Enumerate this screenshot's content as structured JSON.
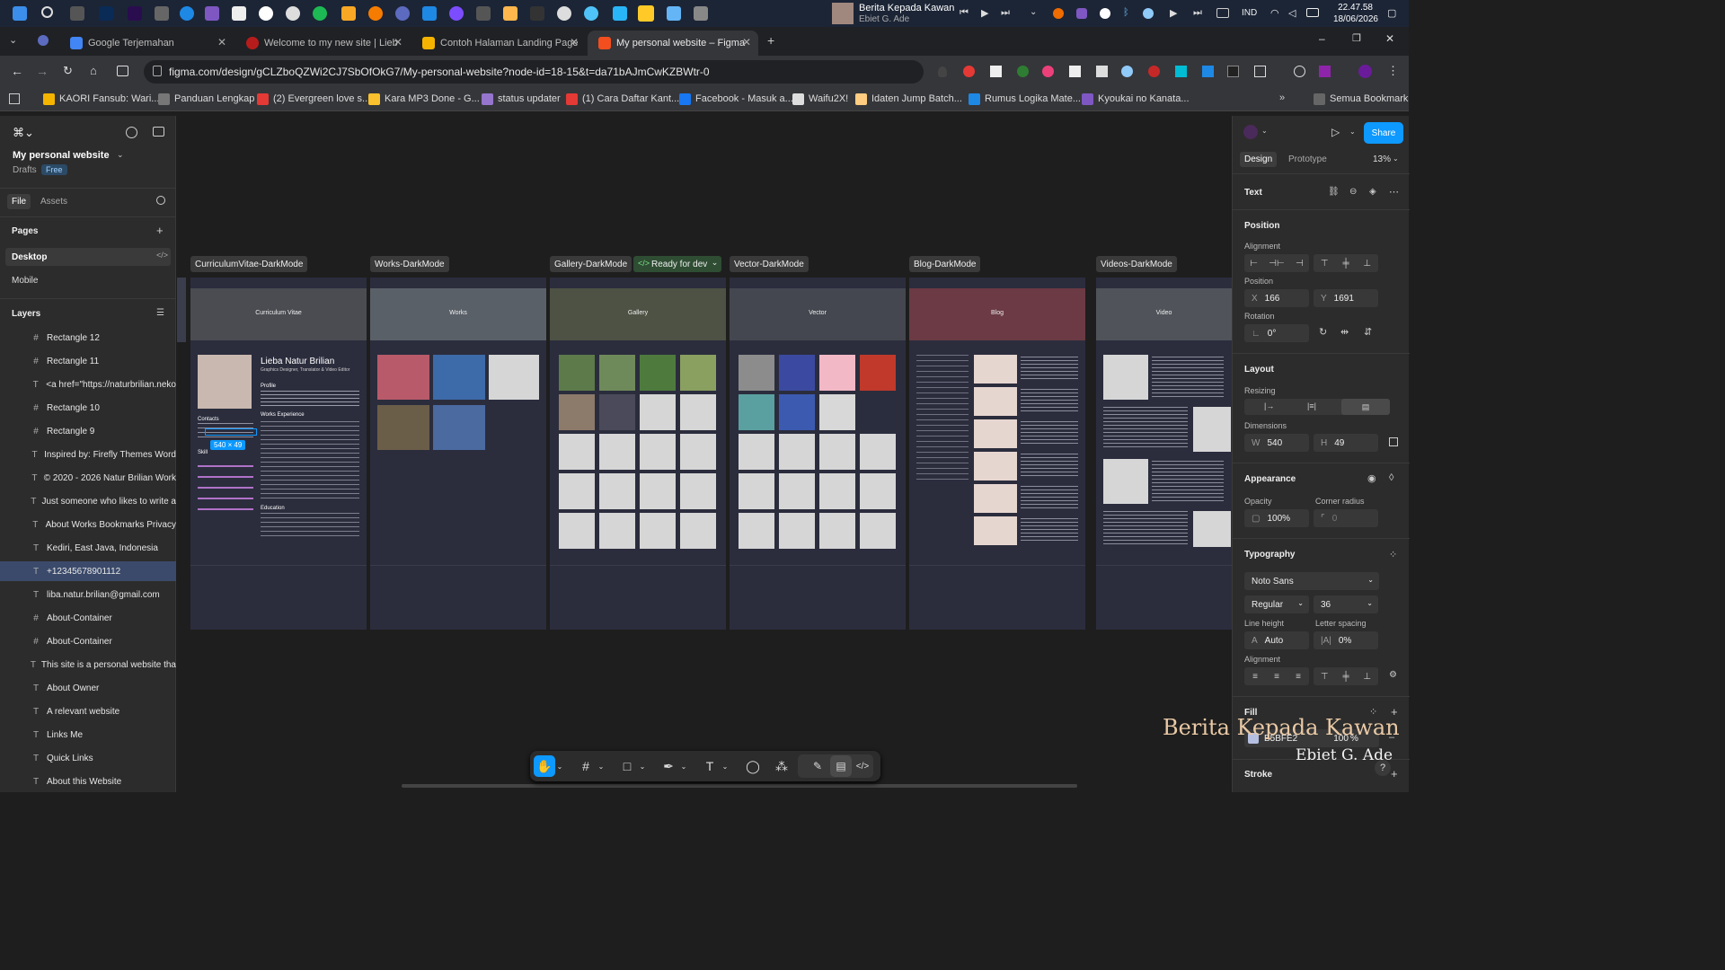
{
  "taskbar": {
    "news_title": "Berita Kepada Kawan",
    "news_artist": "Ebiet G. Ade",
    "lang": "IND",
    "time": "22.47.58",
    "date": "18/06/2026"
  },
  "tabs": [
    {
      "label": "Google Terjemahan"
    },
    {
      "label": "Welcome to my new site | Lieb"
    },
    {
      "label": "Contoh Halaman Landing Page"
    },
    {
      "label": "My personal website – Figma"
    }
  ],
  "url": "figma.com/design/gCLZboQZWi2CJ7SbOfOkG7/My-personal-website?node-id=18-15&t=da71bAJmCwKZBWtr-0",
  "bookmarks": [
    "KAORI Fansub: Wari...",
    "Panduan Lengkap",
    "(2) Evergreen love s...",
    "Kara MP3 Done - G...",
    "status updater",
    "(1) Cara Daftar Kant...",
    "Facebook - Masuk a...",
    "Waifu2X!",
    "Idaten Jump Batch...",
    "Rumus Logika Mate...",
    "Kyoukai no Kanata..."
  ],
  "all_bookmarks": "Semua Bookmark",
  "left": {
    "file_name": "My personal website",
    "drafts": "Drafts",
    "plan": "Free",
    "file_tab": "File",
    "assets_tab": "Assets",
    "pages_title": "Pages",
    "pages": [
      "Desktop",
      "Mobile"
    ],
    "layers_title": "Layers",
    "layers": [
      {
        "icon": "#",
        "label": "Rectangle 12"
      },
      {
        "icon": "#",
        "label": "Rectangle 11"
      },
      {
        "icon": "T",
        "label": "<a href=\"https://naturbrilian.neko"
      },
      {
        "icon": "#",
        "label": "Rectangle 10"
      },
      {
        "icon": "#",
        "label": "Rectangle 9"
      },
      {
        "icon": "T",
        "label": "Inspired by: Firefly Themes Word"
      },
      {
        "icon": "T",
        "label": "© 2020 - 2026 Natur Brilian Work"
      },
      {
        "icon": "T",
        "label": "Just someone who likes to write a"
      },
      {
        "icon": "T",
        "label": "About Works Bookmarks Privacy"
      },
      {
        "icon": "T",
        "label": "Kediri, East Java, Indonesia"
      },
      {
        "icon": "T",
        "label": "+12345678901112"
      },
      {
        "icon": "T",
        "label": "liba.natur.brilian@gmail.com"
      },
      {
        "icon": "#",
        "label": "About-Container"
      },
      {
        "icon": "#",
        "label": "About-Container"
      },
      {
        "icon": "T",
        "label": "This site is a personal website tha"
      },
      {
        "icon": "T",
        "label": "About Owner"
      },
      {
        "icon": "T",
        "label": "A relevant website"
      },
      {
        "icon": "T",
        "label": "Links Me"
      },
      {
        "icon": "T",
        "label": "Quick Links"
      },
      {
        "icon": "T",
        "label": "About this Website"
      }
    ]
  },
  "frames": [
    {
      "label": "CurriculumVitae-DarkMode",
      "hero": "Curriculum Vitae"
    },
    {
      "label": "Works-DarkMode",
      "hero": "Works"
    },
    {
      "label": "Gallery-DarkMode",
      "hero": "Gallery"
    },
    {
      "label": "Vector-DarkMode",
      "hero": "Vector"
    },
    {
      "label": "Blog-DarkMode",
      "hero": "Blog"
    },
    {
      "label": "Videos-DarkMode",
      "hero": "Video"
    }
  ],
  "ready_for_dev": "Ready for dev",
  "cv": {
    "name": "Lieba Natur Brilian",
    "role": "Graphics Designer, Translator & Video Editor",
    "profile": "Profile",
    "works_exp": "Works Experience",
    "contacts": "Contacts",
    "skills": "Skill",
    "education": "Education",
    "selection_size": "540 × 49"
  },
  "right": {
    "share": "Share",
    "design_tab": "Design",
    "prototype_tab": "Prototype",
    "zoom": "13%",
    "section_text": "Text",
    "position": "Position",
    "alignment": "Alignment",
    "pos_label": "Position",
    "x_key": "X",
    "x": "166",
    "y_key": "Y",
    "y": "1691",
    "rotation_label": "Rotation",
    "rotation": "0°",
    "layout": "Layout",
    "resizing": "Resizing",
    "dimensions": "Dimensions",
    "w_key": "W",
    "w": "540",
    "h_key": "H",
    "h": "49",
    "appearance": "Appearance",
    "opacity_label": "Opacity",
    "opacity": "100%",
    "radius_label": "Corner radius",
    "radius": "0",
    "typography": "Typography",
    "font": "Noto Sans",
    "weight": "Regular",
    "size": "36",
    "line_height_label": "Line height",
    "line_height": "Auto",
    "letter_label": "Letter spacing",
    "letter": "0%",
    "alignment2": "Alignment",
    "fill": "Fill",
    "fill_hex": "B5BFE2",
    "fill_op": "100",
    "stroke": "Stroke"
  },
  "colors": {
    "accent": "#0d99ff",
    "selection": "#3b4a6b",
    "frame_bg": "#2b2d3d"
  },
  "watermark": {
    "title": "Berita Kepada Kawan",
    "artist": "Ebiet G. Ade"
  }
}
